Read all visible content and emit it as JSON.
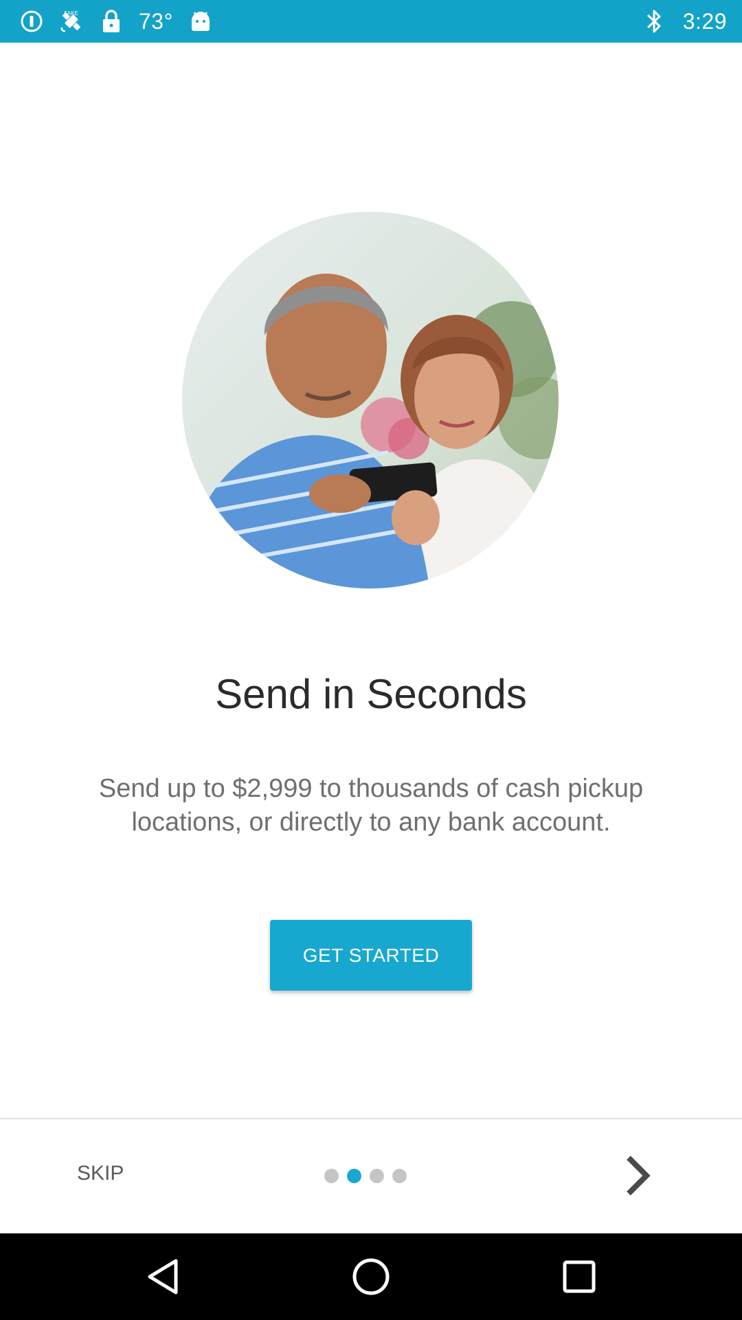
{
  "status_bar": {
    "temperature": "73°",
    "time": "3:29",
    "left_icons": [
      "info-icon",
      "fake-gps-icon",
      "lock-icon",
      "weather-temp",
      "android-icon"
    ],
    "right_icons": [
      "bluetooth-icon"
    ],
    "background_color": "#14a3c8"
  },
  "onboarding": {
    "hero_image": "couple-using-phone-photo",
    "title": "Send in Seconds",
    "subtitle": "Send up to $2,999 to thousands of cash pickup locations, or directly to any bank account.",
    "cta_label": "GET STARTED",
    "accent_color": "#18a8cf"
  },
  "footer": {
    "skip_label": "SKIP",
    "page_count": 4,
    "active_page_index": 1,
    "next_icon": "chevron-right-icon"
  },
  "nav_bar": {
    "buttons": [
      "back-icon",
      "home-icon",
      "recents-icon"
    ]
  }
}
